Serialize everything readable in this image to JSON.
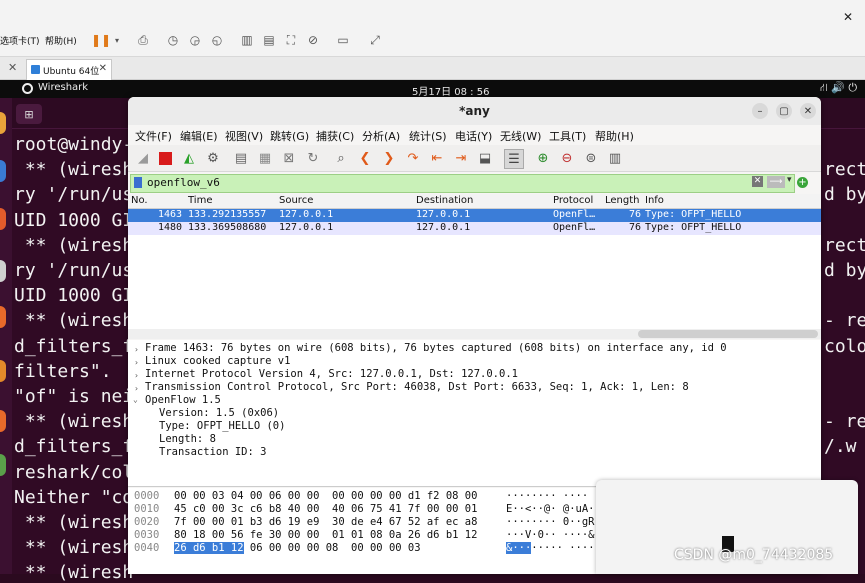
{
  "host": {
    "close_glyph": "✕",
    "menu": [
      "选项卡(T)",
      "帮助(H)"
    ],
    "toolbar_icons": [
      "pause-icon",
      "dropdown-icon",
      "send-keys-icon",
      "snapshot-icon",
      "snapshot-revert-icon",
      "snapshot-manager-icon",
      "view-sidebar-icon",
      "view-console-icon",
      "fullscreen-icon",
      "unity-icon",
      "terminal-icon",
      "stretch-icon"
    ],
    "tab_label": "Ubuntu 64位",
    "tab_close": "✕",
    "tabs_close": "✕"
  },
  "ubuntu": {
    "app_name": "Wireshark",
    "clock": "5月17日  08 : 56",
    "sys_icons": "⛙  🔊  ⏻"
  },
  "terminal": {
    "header_btn": "⊞",
    "lines": [
      "root@windy-",
      " ** (wiresha",
      "ry '/run/use",
      "UID 1000 GI",
      " ** (wiresha",
      "ry '/run/use",
      "UID 1000 GI",
      " ** (wiresha",
      "d_filters_f",
      "filters\".",
      "\"of\" is nei",
      " ** (wiresha",
      "d_filters_fi",
      "reshark/col",
      "Neither \"cd",
      " ** (wiresh",
      " ** (wiresh",
      " ** (wiresh"
    ],
    "right_lines": [
      {
        "row": 1,
        "text": "rect"
      },
      {
        "row": 2,
        "text": "d by"
      },
      {
        "row": 4,
        "text": "rect"
      },
      {
        "row": 5,
        "text": "d by"
      },
      {
        "row": 7,
        "text": "- re"
      },
      {
        "row": 8,
        "text": "colo"
      },
      {
        "row": 11,
        "text": "- re"
      },
      {
        "row": 12,
        "text": "/.w"
      }
    ]
  },
  "wireshark": {
    "title": "*any",
    "win_buttons": [
      "–",
      "▢",
      "✕"
    ],
    "menu": [
      "文件(F)",
      "编辑(E)",
      "视图(V)",
      "跳转(G)",
      "捕获(C)",
      "分析(A)",
      "统计(S)",
      "电话(Y)",
      "无线(W)",
      "工具(T)",
      "帮助(H)"
    ],
    "filter": {
      "value": "openflow_v6",
      "clear": "✕",
      "apply": "⟶",
      "dropdown": "▾",
      "add": "+"
    },
    "columns": [
      "No.",
      "Time",
      "Source",
      "Destination",
      "Protocol",
      "Length",
      "Info"
    ],
    "packets": [
      {
        "no": "1463",
        "time": "133.292135557",
        "src": "127.0.0.1",
        "dst": "127.0.0.1",
        "proto": "OpenFl…",
        "len": "76",
        "info": "Type: OFPT_HELLO",
        "selected": true
      },
      {
        "no": "1480",
        "time": "133.369508680",
        "src": "127.0.0.1",
        "dst": "127.0.0.1",
        "proto": "OpenFl…",
        "len": "76",
        "info": "Type: OFPT_HELLO",
        "selected": false
      }
    ],
    "details": [
      {
        "indent": 0,
        "arrow": "›",
        "text": "Frame 1463: 76 bytes on wire (608 bits), 76 bytes captured (608 bits) on interface any, id 0"
      },
      {
        "indent": 0,
        "arrow": "›",
        "text": "Linux cooked capture v1"
      },
      {
        "indent": 0,
        "arrow": "›",
        "text": "Internet Protocol Version 4, Src: 127.0.0.1, Dst: 127.0.0.1"
      },
      {
        "indent": 0,
        "arrow": "›",
        "text": "Transmission Control Protocol, Src Port: 46038, Dst Port: 6633, Seq: 1, Ack: 1, Len: 8"
      },
      {
        "indent": 0,
        "arrow": "⌄",
        "text": "OpenFlow 1.5"
      },
      {
        "indent": 1,
        "arrow": "",
        "text": "Version: 1.5 (0x06)"
      },
      {
        "indent": 1,
        "arrow": "",
        "text": "Type: OFPT_HELLO (0)"
      },
      {
        "indent": 1,
        "arrow": "",
        "text": "Length: 8"
      },
      {
        "indent": 1,
        "arrow": "",
        "text": "Transaction ID: 3"
      }
    ],
    "bytes": [
      {
        "off": "0000",
        "hex": "00 00 03 04 00 06 00 00  00 00 00 00 d1 f2 08 00",
        "asc": "········ ····"
      },
      {
        "off": "0010",
        "hex": "45 c0 00 3c c6 b8 40 00  40 06 75 41 7f 00 00 01",
        "asc": "E··<··@· @·uA·"
      },
      {
        "off": "0020",
        "hex": "7f 00 00 01 b3 d6 19 e9  30 de e4 67 52 af ec a8",
        "asc": "········ 0··gR"
      },
      {
        "off": "0030",
        "hex": "80 18 00 56 fe 30 00 00  01 01 08 0a 26 d6 b1 12",
        "asc": "···V·0·· ····&"
      },
      {
        "off": "0040",
        "hex_hl": "26 d6 b1 12",
        "hex": " 06 00 00 00 08  00 00 00 03",
        "asc_hl": "&···",
        "asc": "····· ····"
      }
    ]
  },
  "watermark": "CSDN @m0_74432085"
}
